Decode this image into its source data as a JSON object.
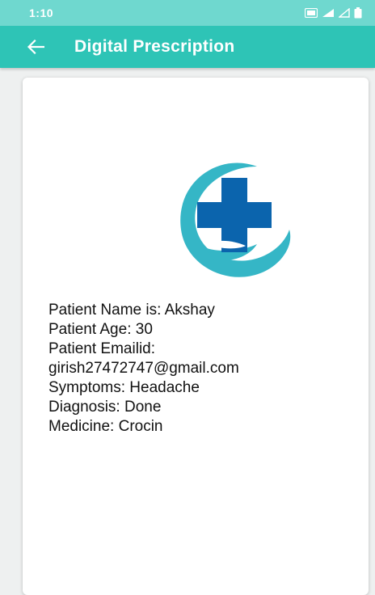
{
  "status_bar": {
    "time": "1:10",
    "icons": [
      "nfc-icon",
      "signal-4g-icon",
      "signal-icon",
      "battery-icon"
    ]
  },
  "app_bar": {
    "back_icon": "arrow-left-icon",
    "title": "Digital Prescription",
    "background": "#2ec4b6"
  },
  "card": {
    "logo_icon": "medical-cross-hand-logo",
    "details": {
      "name": "Patient Name is: Akshay",
      "age": "Patient Age:  30",
      "email_label": "Patient Emailid:",
      "email": "girish27472747@gmail.com",
      "symptoms": "Symptoms: Headache",
      "diagnosis": "Diagnosis: Done",
      "medicine": "Medicine: Crocin"
    }
  },
  "colors": {
    "status_bar": "#6fd8cf",
    "teal": "#2ec4b6",
    "logo_blue": "#0b64ad",
    "logo_teal": "#35b6c6"
  }
}
